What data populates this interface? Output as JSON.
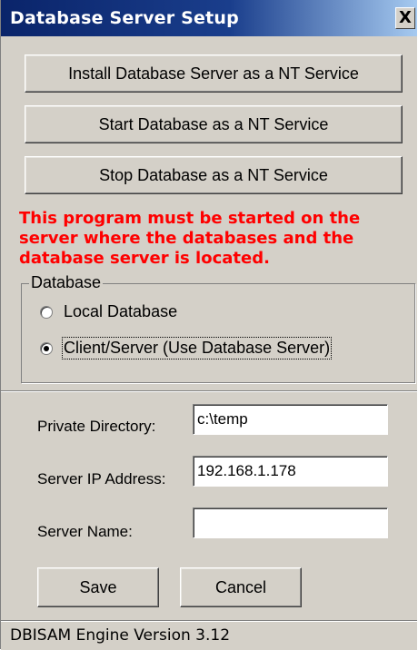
{
  "window": {
    "title": "Database Server Setup",
    "close_label": "X"
  },
  "buttons": {
    "install": "Install Database Server as a NT Service",
    "start": "Start Database as a NT Service",
    "stop": "Stop Database as a NT Service",
    "save": "Save",
    "cancel": "Cancel"
  },
  "warning": "This program must be started on the server where the databases and the database server is located.",
  "database_group": {
    "legend": "Database",
    "options": [
      {
        "label": "Local Database",
        "checked": false
      },
      {
        "label": "Client/Server (Use Database Server)",
        "checked": true
      }
    ]
  },
  "fields": {
    "private_directory": {
      "label": "Private Directory:",
      "value": "c:\\temp"
    },
    "server_ip": {
      "label": "Server IP Address:",
      "value": "192.168.1.178"
    },
    "server_name": {
      "label": "Server Name:",
      "value": ""
    }
  },
  "status": {
    "text": "DBISAM Engine Version 3.12"
  },
  "colors": {
    "title_bar": "#0a246a",
    "warning": "#ff0000",
    "face": "#d4d0c8"
  }
}
